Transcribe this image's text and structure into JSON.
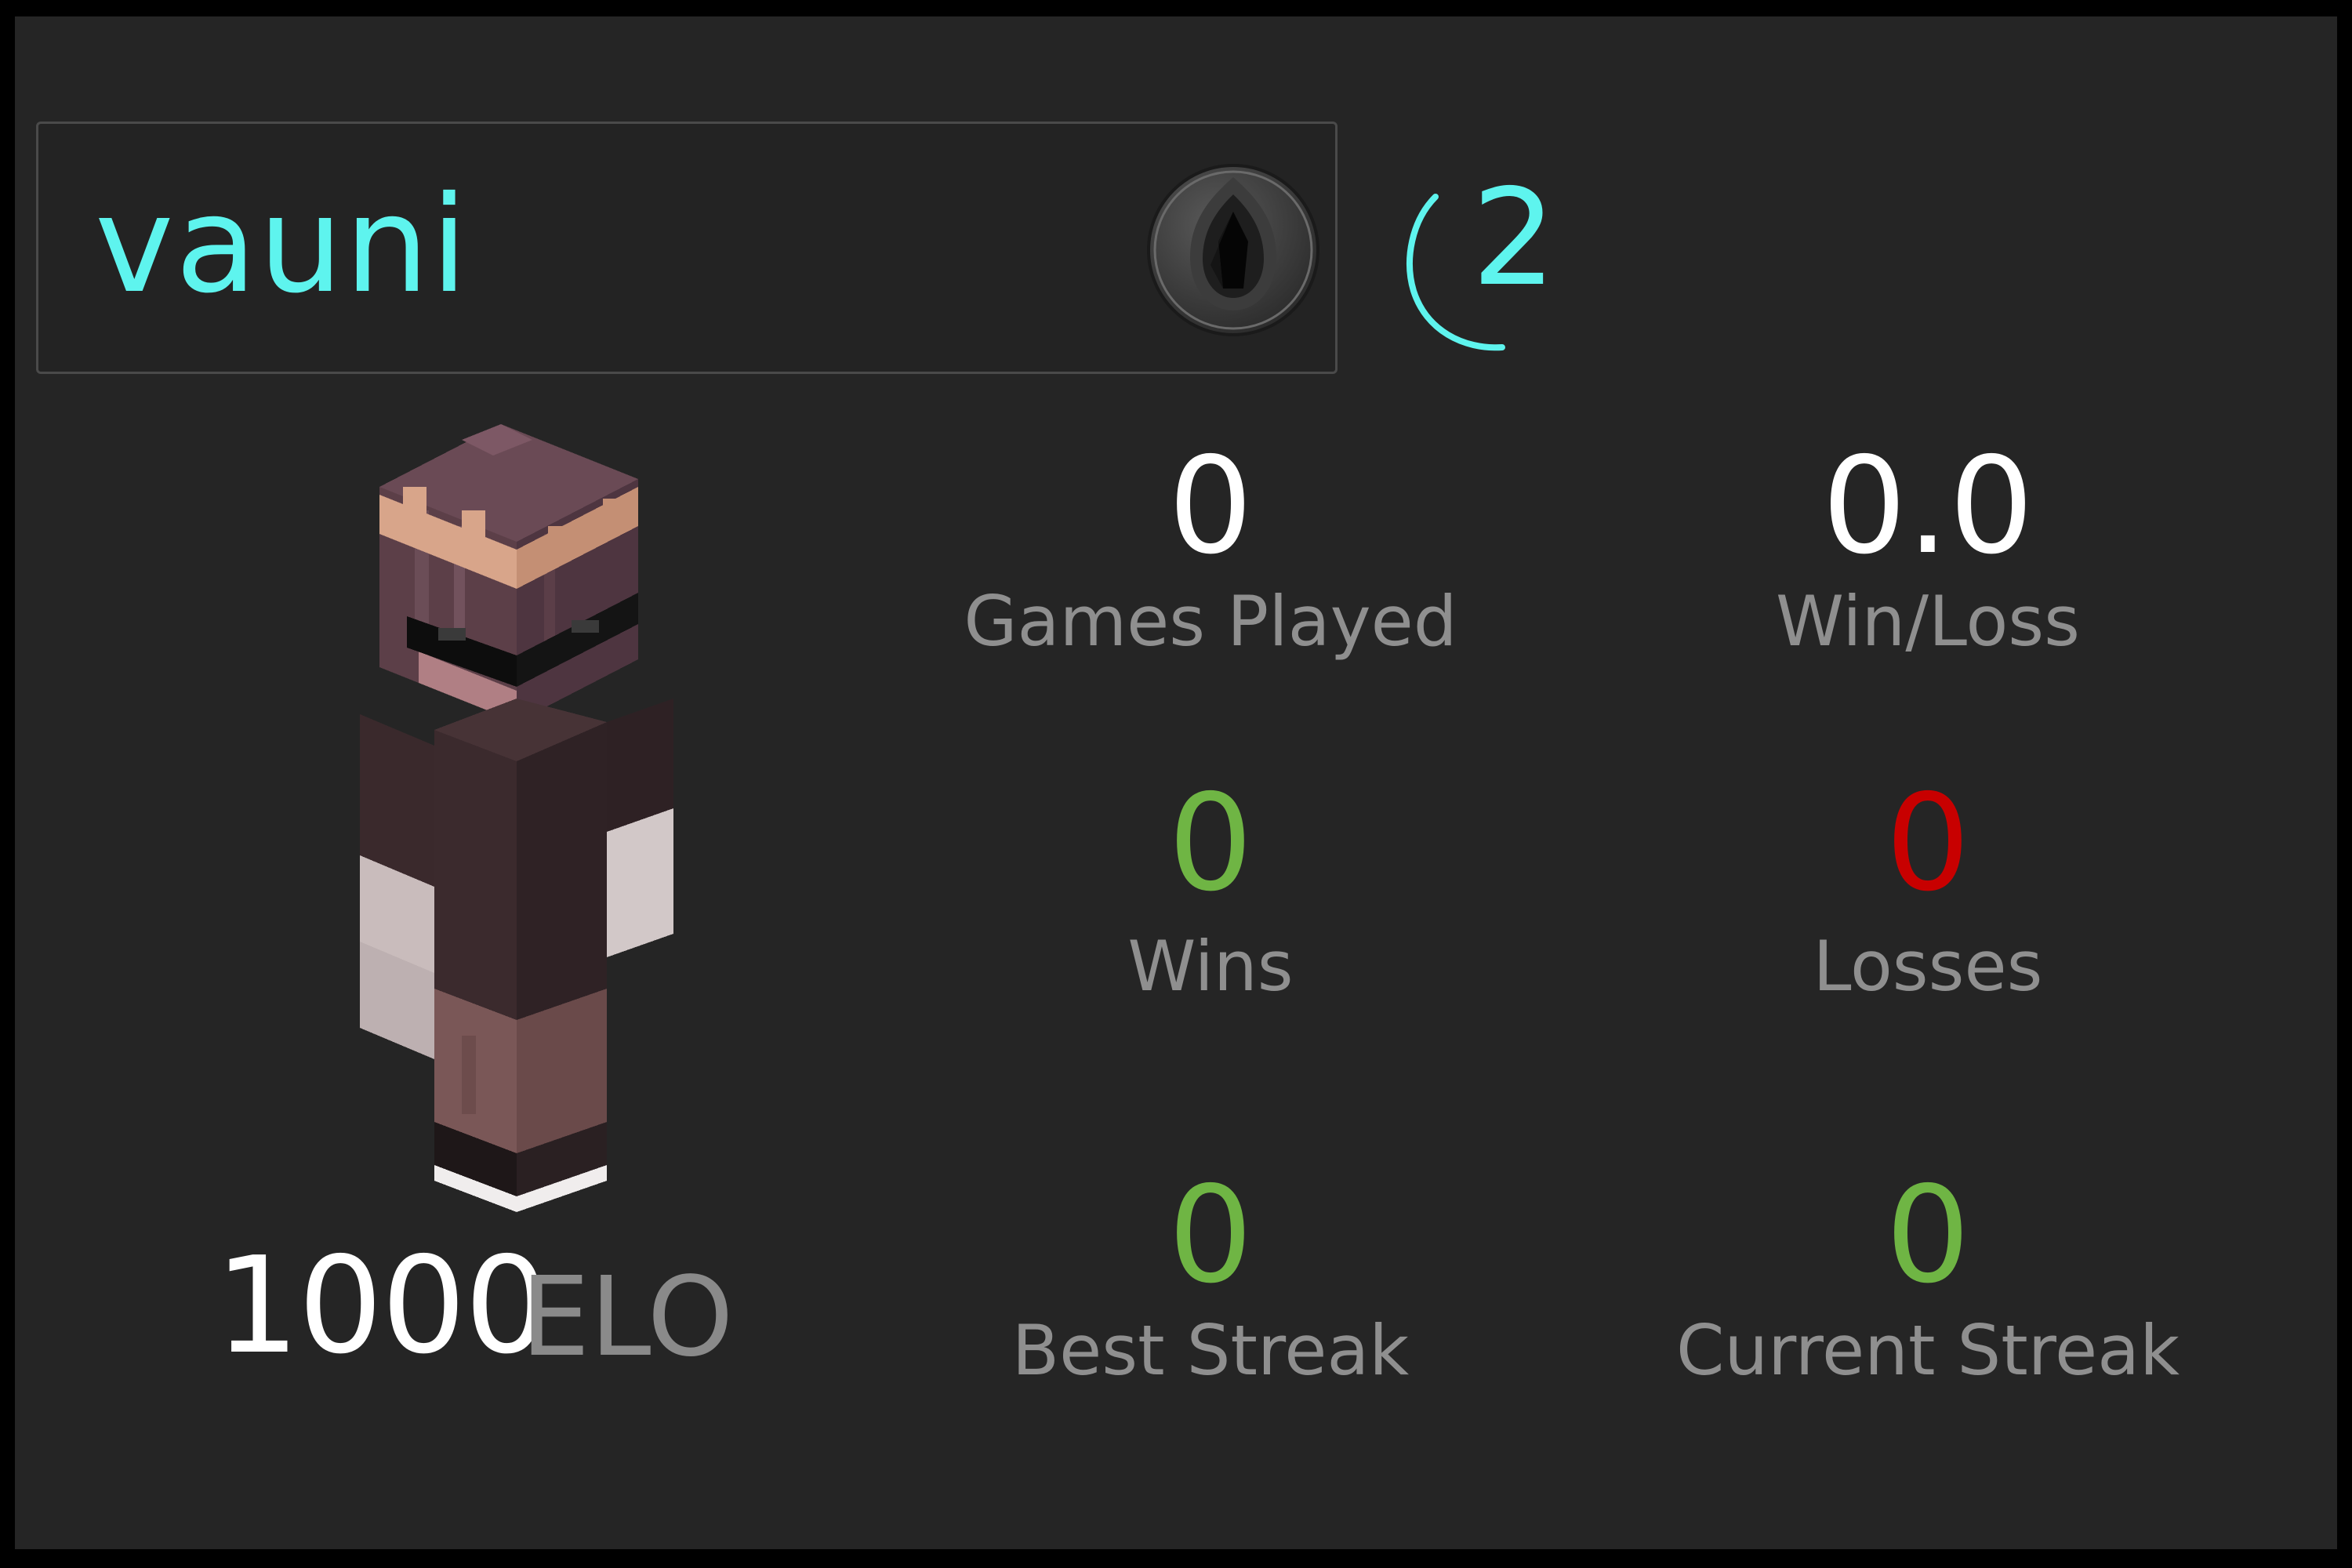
{
  "player": {
    "name": "vauni",
    "level": "2",
    "elo": "1000",
    "elo_unit": "ELO"
  },
  "badge": {
    "icon": "obsidian-gem-icon"
  },
  "colors": {
    "accent": "#5ef4ee",
    "white": "#ffffff",
    "label": "#8f8f8f",
    "positive": "#6fb544",
    "negative": "#c80000",
    "background": "#252525"
  },
  "stats": {
    "games_played": {
      "value": "0",
      "label": "Games Played"
    },
    "win_loss": {
      "value": "0.0",
      "label": "Win/Loss"
    },
    "wins": {
      "value": "0",
      "label": "Wins"
    },
    "losses": {
      "value": "0",
      "label": "Losses"
    },
    "best_streak": {
      "value": "0",
      "label": "Best Streak"
    },
    "current_streak": {
      "value": "0",
      "label": "Current Streak"
    }
  }
}
